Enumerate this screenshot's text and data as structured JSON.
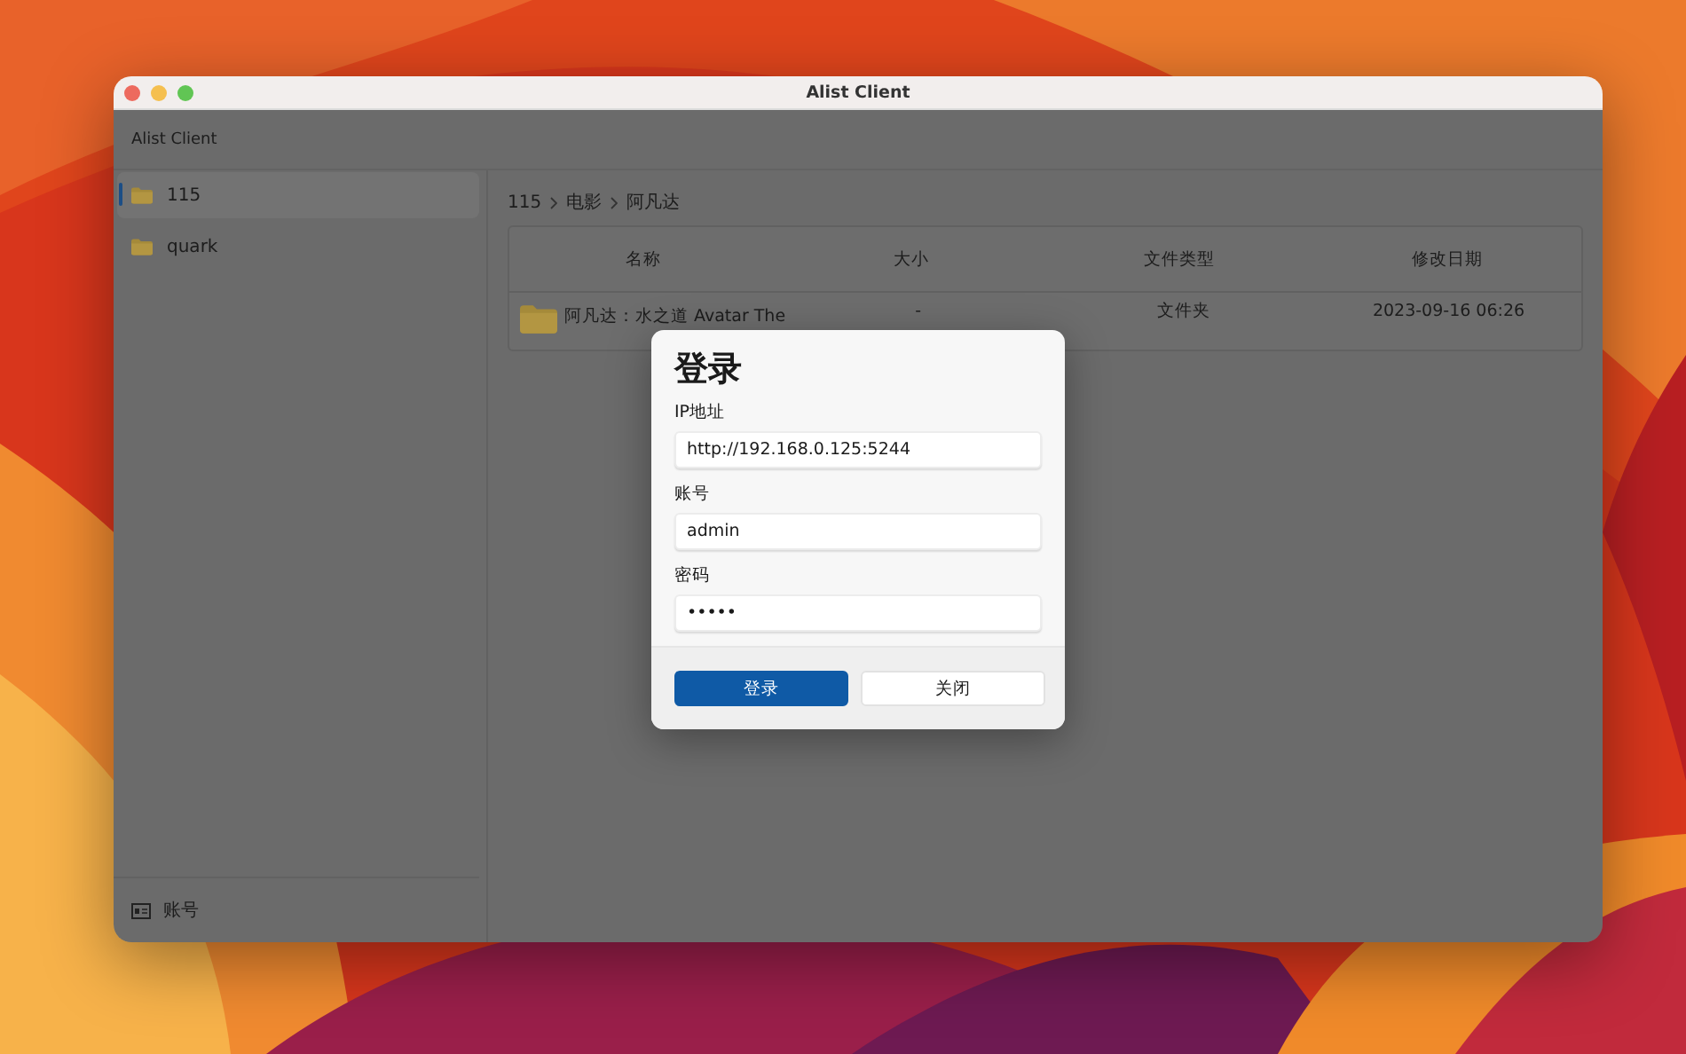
{
  "window": {
    "title": "Alist Client"
  },
  "app_bar": {
    "title": "Alist Client"
  },
  "sidebar": {
    "items": [
      {
        "label": "115",
        "selected": true
      },
      {
        "label": "quark",
        "selected": false
      }
    ],
    "footer": {
      "label": "账号"
    }
  },
  "breadcrumb": [
    "115",
    "电影",
    "阿凡达"
  ],
  "table": {
    "columns": [
      "名称",
      "大小",
      "文件类型",
      "修改日期"
    ],
    "rows": [
      {
        "cells": [
          "阿凡达：水之道 Avatar The",
          "-",
          "文件夹",
          "2023-09-16 06:26"
        ]
      }
    ]
  },
  "dialog": {
    "title": "登录",
    "fields": [
      {
        "label": "IP地址",
        "value": "http://192.168.0.125:5244"
      },
      {
        "label": "账号",
        "value": "admin"
      },
      {
        "label": "密码",
        "value": "•••••"
      }
    ],
    "buttons": [
      {
        "label": "登录",
        "primary": true
      },
      {
        "label": "关闭",
        "primary": false
      }
    ]
  }
}
